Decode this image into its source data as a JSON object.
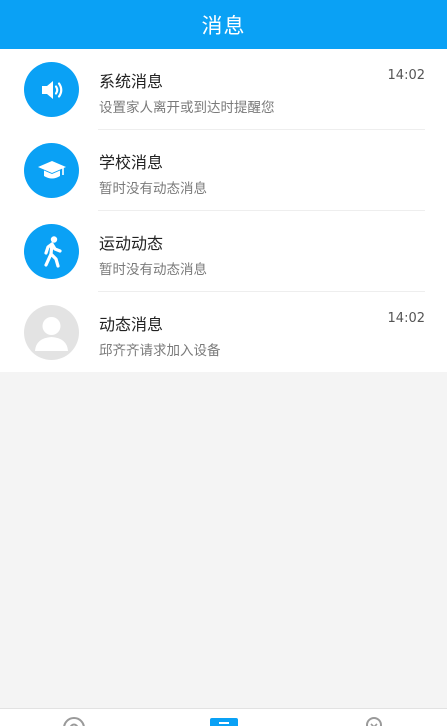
{
  "header": {
    "title": "消息"
  },
  "colors": {
    "accent": "#0aa1f5",
    "inactive_avatar": "#e3e3e3"
  },
  "messages": [
    {
      "icon": "speaker-icon",
      "title": "系统消息",
      "subtitle": "设置家人离开或到达时提醒您",
      "time": "14:02"
    },
    {
      "icon": "graduation-cap-icon",
      "title": "学校消息",
      "subtitle": "暂时没有动态消息",
      "time": ""
    },
    {
      "icon": "walking-person-icon",
      "title": "运动动态",
      "subtitle": "暂时没有动态消息",
      "time": ""
    },
    {
      "icon": "person-avatar-icon",
      "title": "动态消息",
      "subtitle": "邱齐齐请求加入设备",
      "time": "14:02"
    }
  ],
  "tabbar": {
    "tabs": [
      {
        "icon": "location-icon"
      },
      {
        "icon": "message-icon",
        "active": true
      },
      {
        "icon": "profile-icon"
      }
    ]
  }
}
